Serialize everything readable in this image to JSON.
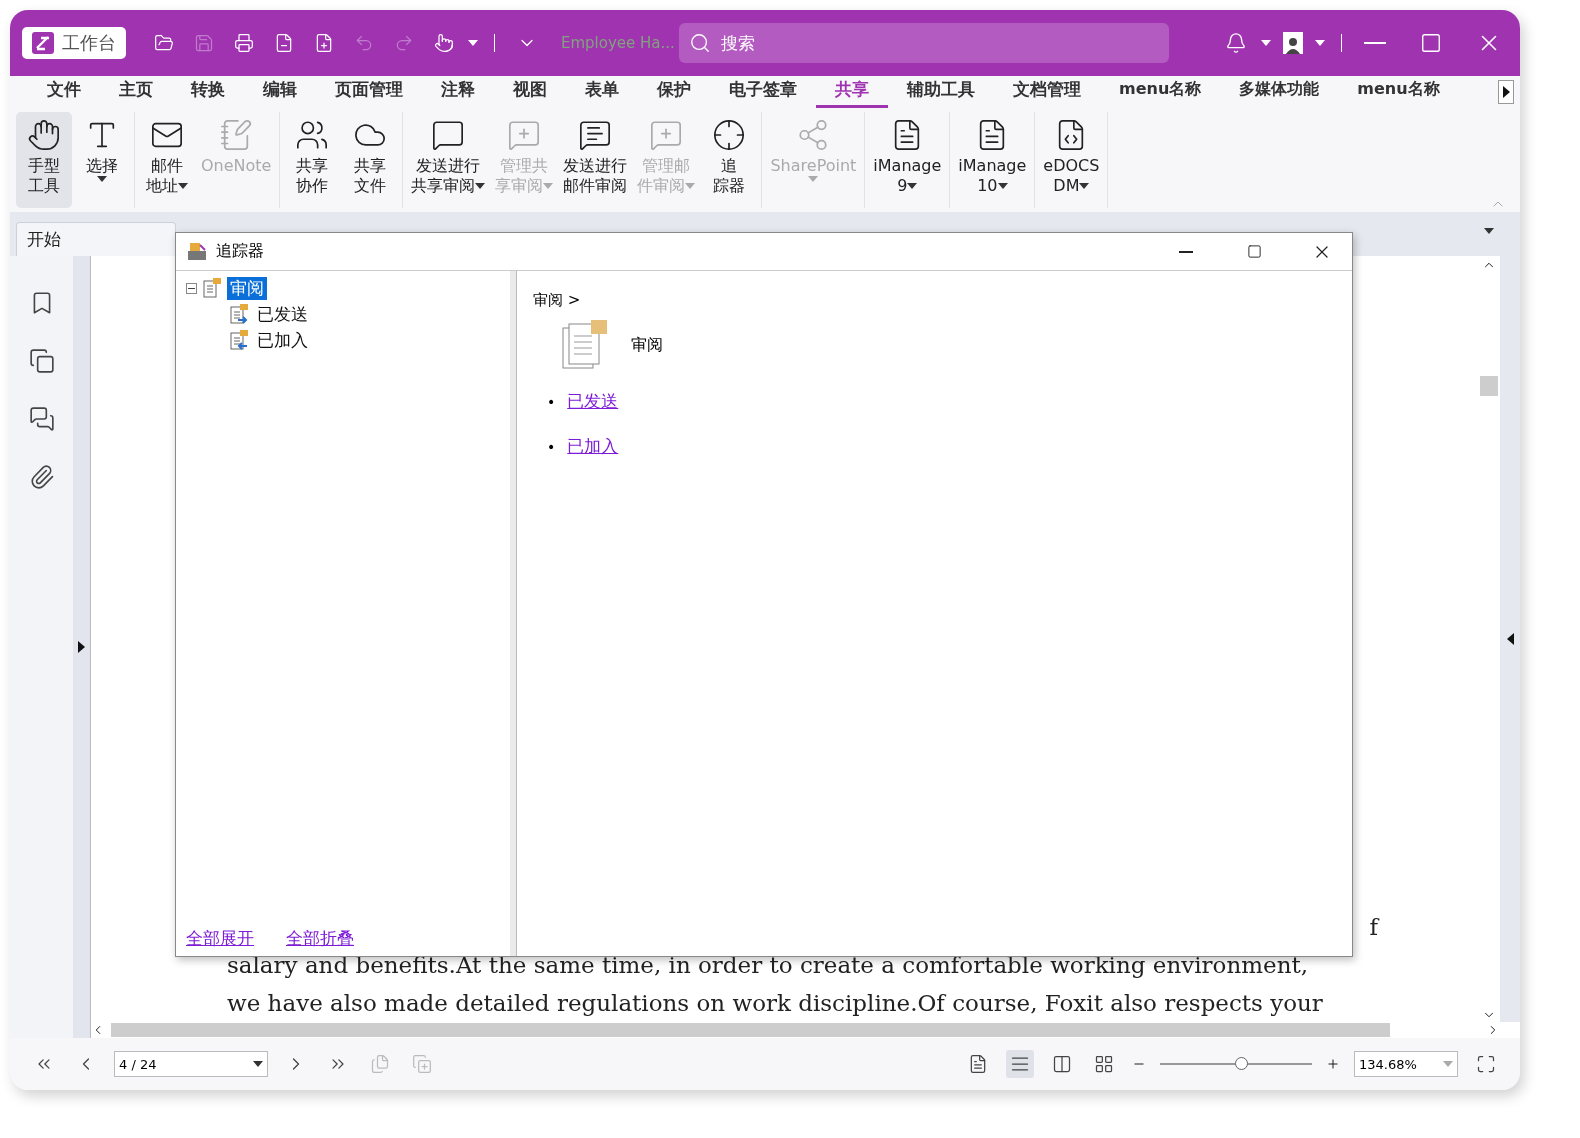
{
  "title_bar": {
    "workspace_button": "工作台",
    "document_title": "Employee Ha...",
    "search": {
      "placeholder": "搜索"
    }
  },
  "menu_tabs": [
    {
      "label": "文件",
      "selected": false
    },
    {
      "label": "主页",
      "selected": false
    },
    {
      "label": "转换",
      "selected": false
    },
    {
      "label": "编辑",
      "selected": false
    },
    {
      "label": "页面管理",
      "selected": false
    },
    {
      "label": "注释",
      "selected": false
    },
    {
      "label": "视图",
      "selected": false
    },
    {
      "label": "表单",
      "selected": false
    },
    {
      "label": "保护",
      "selected": false
    },
    {
      "label": "电子签章",
      "selected": false
    },
    {
      "label": "共享",
      "selected": true
    },
    {
      "label": "辅助工具",
      "selected": false
    },
    {
      "label": "文档管理",
      "selected": false
    },
    {
      "label": "menu名称",
      "selected": false
    },
    {
      "label": "多媒体功能",
      "selected": false
    },
    {
      "label": "menu名称",
      "selected": false
    }
  ],
  "ribbon_groups": [
    [
      {
        "kind": "hand",
        "lines": [
          "手型",
          "工具"
        ],
        "selected": true,
        "disabled": false,
        "dropdown": false
      },
      {
        "kind": "select",
        "lines": [
          "选择"
        ],
        "selected": false,
        "disabled": false,
        "dropdown": true
      }
    ],
    [
      {
        "kind": "mail",
        "lines": [
          "邮件",
          "地址"
        ],
        "selected": false,
        "disabled": false,
        "dropdown": true
      },
      {
        "kind": "onenote",
        "lines": [
          "OneNote"
        ],
        "selected": false,
        "disabled": true,
        "dropdown": false
      }
    ],
    [
      {
        "kind": "share-collab",
        "lines": [
          "共享",
          "协作"
        ],
        "selected": false,
        "disabled": false,
        "dropdown": false
      },
      {
        "kind": "share-file",
        "lines": [
          "共享",
          "文件"
        ],
        "selected": false,
        "disabled": false,
        "dropdown": false
      }
    ],
    [
      {
        "kind": "send-review",
        "lines": [
          "发送进行",
          "共享审阅"
        ],
        "selected": false,
        "disabled": false,
        "dropdown": true
      },
      {
        "kind": "manage-review",
        "lines": [
          "管理共",
          "享审阅"
        ],
        "selected": false,
        "disabled": true,
        "dropdown": true
      },
      {
        "kind": "send-mail",
        "lines": [
          "发送进行",
          "邮件审阅"
        ],
        "selected": false,
        "disabled": false,
        "dropdown": false
      },
      {
        "kind": "manage-mail",
        "lines": [
          "管理邮",
          "件审阅"
        ],
        "selected": false,
        "disabled": true,
        "dropdown": true
      },
      {
        "kind": "tracker",
        "lines": [
          "追",
          "踪器"
        ],
        "selected": false,
        "disabled": false,
        "dropdown": false
      }
    ],
    [
      {
        "kind": "sharepoint",
        "lines": [
          "SharePoint"
        ],
        "selected": false,
        "disabled": true,
        "dropdown": true
      }
    ],
    [
      {
        "kind": "imanage",
        "lines": [
          "iManage",
          "9"
        ],
        "selected": false,
        "disabled": false,
        "dropdown": true
      }
    ],
    [
      {
        "kind": "imanage",
        "lines": [
          "iManage",
          "10"
        ],
        "selected": false,
        "disabled": false,
        "dropdown": true
      }
    ],
    [
      {
        "kind": "edocs",
        "lines": [
          "eDOCS",
          "DM"
        ],
        "selected": false,
        "disabled": false,
        "dropdown": true
      }
    ]
  ],
  "doc_tabs": [
    {
      "label": "开始",
      "selected": true
    }
  ],
  "document": {
    "lines": [
      "f",
      "salary and benefits.At the same time, in order to create a comfortable working environment,",
      "we have also made detailed regulations on work discipline.Of course, Foxit also respects your"
    ]
  },
  "dialog": {
    "title": "追踪器",
    "tree": [
      {
        "label": "审阅",
        "selected": true,
        "expanded": true,
        "children": [
          {
            "label": "已发送",
            "selected": false,
            "kind": "sent"
          },
          {
            "label": "已加入",
            "selected": false,
            "kind": "joined"
          }
        ]
      }
    ],
    "breadcrumb": "审阅 >",
    "heading": "审阅",
    "links": [
      {
        "marker": "•",
        "label": "已发送"
      },
      {
        "marker": "•",
        "label": "已加入"
      }
    ],
    "footer_links": [
      "全部展开",
      "全部折叠"
    ]
  },
  "status_bar": {
    "page": "4 / 24",
    "views": [
      {
        "kind": "single",
        "selected": false
      },
      {
        "kind": "continuous",
        "selected": true
      },
      {
        "kind": "facing",
        "selected": false
      },
      {
        "kind": "continuous-facing",
        "selected": false
      }
    ],
    "zoom_slider": {
      "level": 0.53
    },
    "zoom": "134.68%"
  }
}
